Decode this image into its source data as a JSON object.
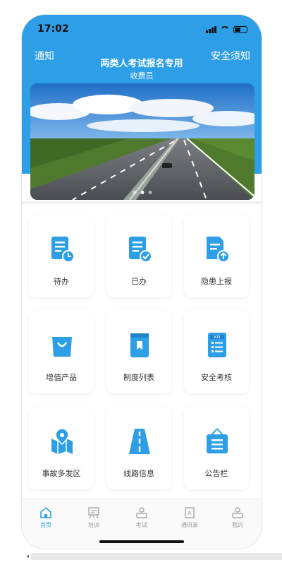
{
  "status_bar": {
    "time": "17:02"
  },
  "header": {
    "notice_label": "通知",
    "safety_label": "安全须知",
    "title": "两类人考试报名专用",
    "subtitle": "收费员",
    "accent_color": "#2E9FE6"
  },
  "banner": {
    "slide_count": 3,
    "active_slide": 2
  },
  "grid": {
    "items": [
      {
        "label": "待办",
        "icon": "pending-doc-icon"
      },
      {
        "label": "已办",
        "icon": "done-doc-icon"
      },
      {
        "label": "隐患上报",
        "icon": "report-upload-icon"
      },
      {
        "label": "增值产品",
        "icon": "shopping-bag-icon"
      },
      {
        "label": "制度列表",
        "icon": "book-icon"
      },
      {
        "label": "安全考核",
        "icon": "kpi-icon"
      },
      {
        "label": "事故多发区",
        "icon": "map-pin-icon"
      },
      {
        "label": "线路信息",
        "icon": "road-icon"
      },
      {
        "label": "公告栏",
        "icon": "bulletin-board-icon"
      }
    ]
  },
  "tabbar": {
    "items": [
      {
        "label": "首页",
        "icon": "home-icon",
        "active": true
      },
      {
        "label": "培训",
        "icon": "training-icon",
        "active": false
      },
      {
        "label": "考试",
        "icon": "exam-icon",
        "active": false
      },
      {
        "label": "通讯录",
        "icon": "contacts-icon",
        "active": false
      },
      {
        "label": "我的",
        "icon": "profile-icon",
        "active": false
      }
    ]
  }
}
